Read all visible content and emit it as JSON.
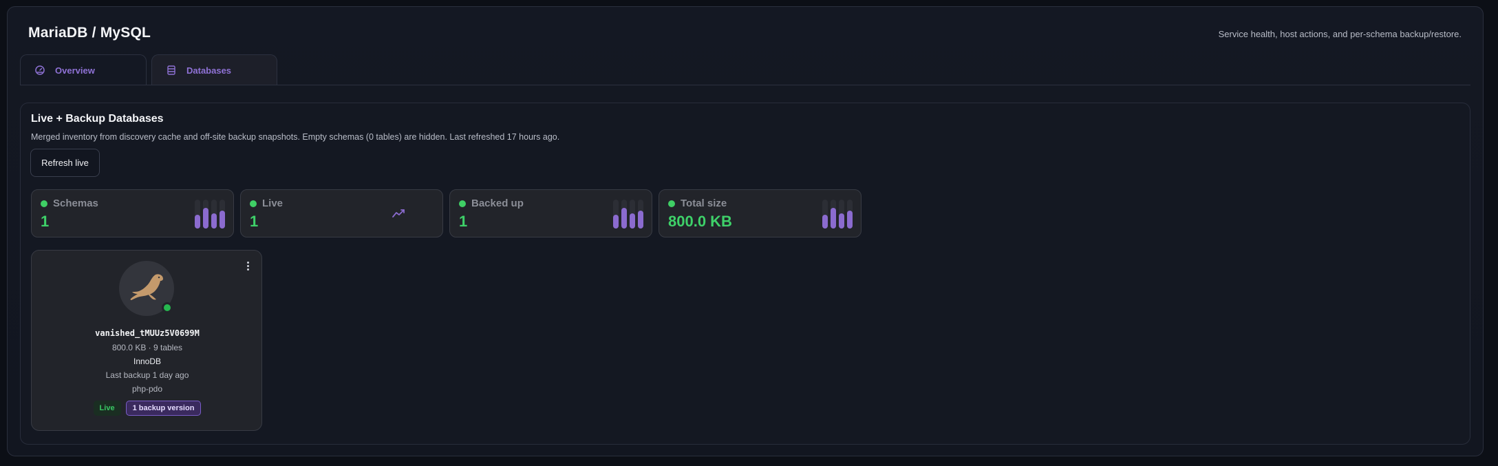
{
  "header": {
    "title": "MariaDB / MySQL",
    "subtitle": "Service health, host actions, and per-schema backup/restore."
  },
  "tabs": [
    {
      "label": "Overview",
      "icon": "gauge-icon",
      "active": false
    },
    {
      "label": "Databases",
      "icon": "database-icon",
      "active": true
    }
  ],
  "section": {
    "title": "Live + Backup Databases",
    "description": "Merged inventory from discovery cache and off-site backup snapshots. Empty schemas (0 tables) are hidden. Last refreshed 17 hours ago.",
    "refresh_label": "Refresh live"
  },
  "stats": [
    {
      "label": "Schemas",
      "value": "1",
      "indicator": "bars"
    },
    {
      "label": "Live",
      "value": "1",
      "indicator": "trend-icon"
    },
    {
      "label": "Backed up",
      "value": "1",
      "indicator": "bars"
    },
    {
      "label": "Total size",
      "value": "800.0 KB",
      "indicator": "bars"
    }
  ],
  "database": {
    "name": "vanished_tMUUz5V0699M",
    "size_tables": "800.0 KB · 9 tables",
    "engine": "InnoDB",
    "last_backup": "Last backup 1 day ago",
    "driver": "php-pdo",
    "status": "online",
    "badges": {
      "live": "Live",
      "backup": "1 backup version"
    }
  },
  "colors": {
    "accent": "#8f72d6",
    "success": "#3ed169",
    "background": "#0c0f16"
  }
}
